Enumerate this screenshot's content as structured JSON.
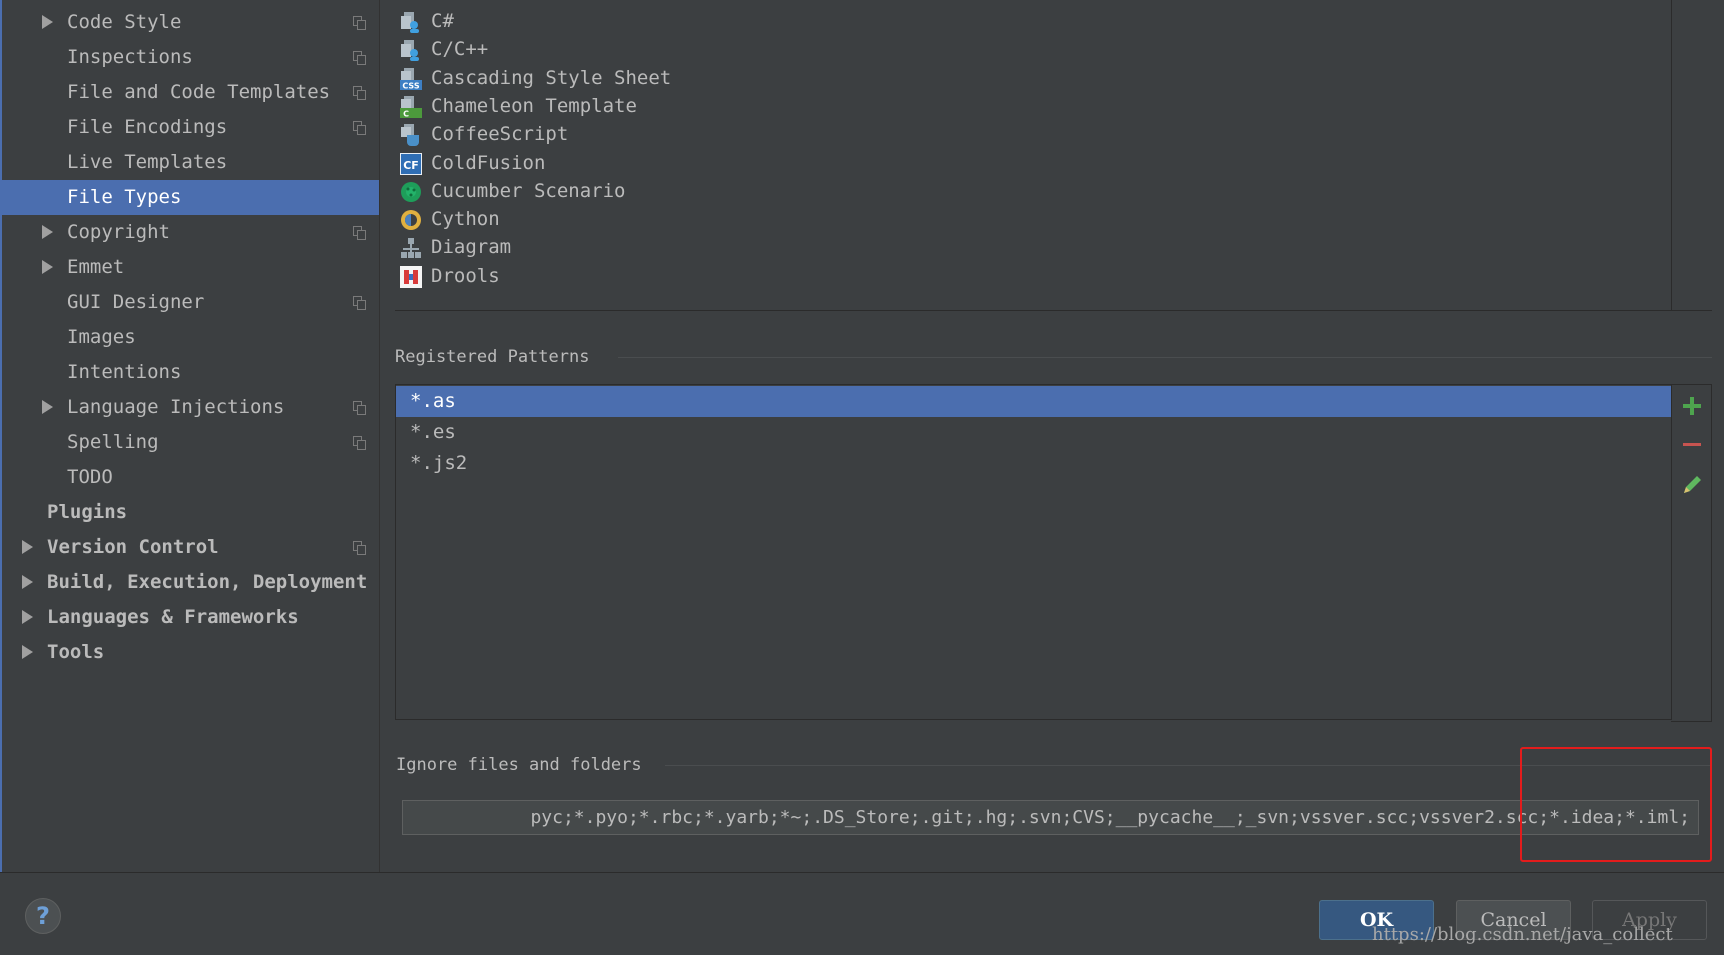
{
  "nav": {
    "items": [
      {
        "label": "Code Style",
        "indent": 2,
        "expandable": true,
        "copy": true,
        "bold": false
      },
      {
        "label": "Inspections",
        "indent": 2,
        "expandable": false,
        "copy": true,
        "bold": false
      },
      {
        "label": "File and Code Templates",
        "indent": 2,
        "expandable": false,
        "copy": true,
        "bold": false
      },
      {
        "label": "File Encodings",
        "indent": 2,
        "expandable": false,
        "copy": true,
        "bold": false
      },
      {
        "label": "Live Templates",
        "indent": 2,
        "expandable": false,
        "copy": false,
        "bold": false
      },
      {
        "label": "File Types",
        "indent": 2,
        "expandable": false,
        "copy": false,
        "bold": false,
        "selected": true
      },
      {
        "label": "Copyright",
        "indent": 2,
        "expandable": true,
        "copy": true,
        "bold": false
      },
      {
        "label": "Emmet",
        "indent": 2,
        "expandable": true,
        "copy": false,
        "bold": false
      },
      {
        "label": "GUI Designer",
        "indent": 2,
        "expandable": false,
        "copy": true,
        "bold": false
      },
      {
        "label": "Images",
        "indent": 2,
        "expandable": false,
        "copy": false,
        "bold": false
      },
      {
        "label": "Intentions",
        "indent": 2,
        "expandable": false,
        "copy": false,
        "bold": false
      },
      {
        "label": "Language Injections",
        "indent": 2,
        "expandable": true,
        "copy": true,
        "bold": false
      },
      {
        "label": "Spelling",
        "indent": 2,
        "expandable": false,
        "copy": true,
        "bold": false
      },
      {
        "label": "TODO",
        "indent": 2,
        "expandable": false,
        "copy": false,
        "bold": false
      },
      {
        "label": "Plugins",
        "indent": 1,
        "expandable": false,
        "copy": false,
        "bold": true
      },
      {
        "label": "Version Control",
        "indent": 1,
        "expandable": true,
        "copy": true,
        "bold": true
      },
      {
        "label": "Build, Execution, Deployment",
        "indent": 1,
        "expandable": true,
        "copy": false,
        "bold": true
      },
      {
        "label": "Languages & Frameworks",
        "indent": 1,
        "expandable": true,
        "copy": false,
        "bold": true
      },
      {
        "label": "Tools",
        "indent": 1,
        "expandable": true,
        "copy": false,
        "bold": true
      }
    ]
  },
  "file_types": [
    {
      "label": "C#",
      "icon": "csharp-file-icon"
    },
    {
      "label": "C/C++",
      "icon": "cpp-file-icon"
    },
    {
      "label": "Cascading Style Sheet",
      "icon": "css-file-icon"
    },
    {
      "label": "Chameleon Template",
      "icon": "chameleon-file-icon"
    },
    {
      "label": "CoffeeScript",
      "icon": "coffeescript-file-icon"
    },
    {
      "label": "ColdFusion",
      "icon": "coldfusion-file-icon"
    },
    {
      "label": "Cucumber Scenario",
      "icon": "cucumber-file-icon"
    },
    {
      "label": "Cython",
      "icon": "cython-file-icon"
    },
    {
      "label": "Diagram",
      "icon": "diagram-file-icon"
    },
    {
      "label": "Drools",
      "icon": "drools-file-icon"
    }
  ],
  "registered_patterns": {
    "title": "Registered Patterns",
    "items": [
      "*.as",
      "*.es",
      "*.js2"
    ],
    "selected_index": 0
  },
  "ignore": {
    "title": "Ignore files and folders",
    "value": "pyc;*.pyo;*.rbc;*.yarb;*~;.DS_Store;.git;.hg;.svn;CVS;__pycache__;_svn;vssver.scc;vssver2.scc;*.idea;*.iml;"
  },
  "buttons": {
    "help": "?",
    "ok": "OK",
    "cancel": "Cancel",
    "apply": "Apply"
  },
  "watermark": "https://blog.csdn.net/java_collect",
  "colors": {
    "background": "#3c3f41",
    "selection": "#4b6eaf",
    "add": "#4ea44e",
    "remove": "#c75450",
    "highlight": "#e31c1c"
  }
}
